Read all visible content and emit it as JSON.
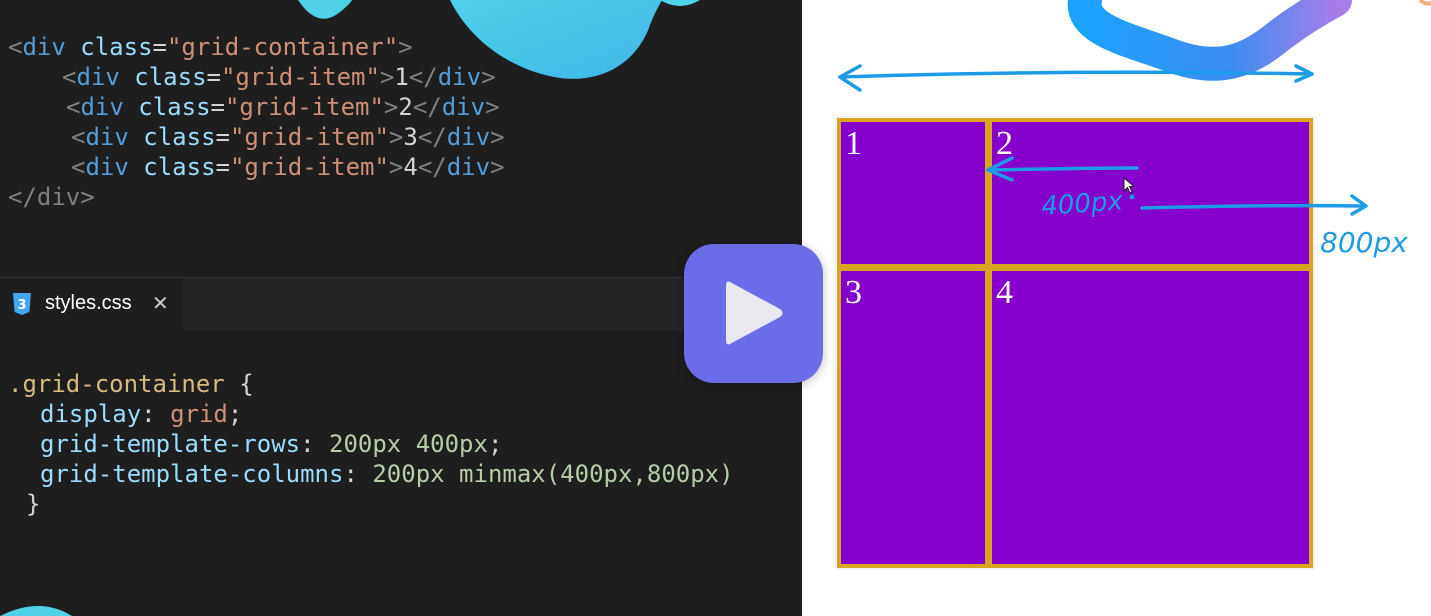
{
  "html_code": {
    "lines": [
      {
        "indent": "",
        "tag": "div",
        "attr": "class",
        "value": "\"grid-container\"",
        "content": ""
      },
      {
        "indent": "   ",
        "tag": "div",
        "attr": "class",
        "value": "\"grid-item\"",
        "content": "1"
      },
      {
        "indent": "   ",
        "tag": "div",
        "attr": "class",
        "value": "\"grid-item\"",
        "content": "2"
      },
      {
        "indent": "   ",
        "tag": "div",
        "attr": "class",
        "value": "\"grid-item\"",
        "content": "3"
      },
      {
        "indent": "   ",
        "tag": "div",
        "attr": "class",
        "value": "\"grid-item\"",
        "content": "4"
      }
    ],
    "closing": "</div>"
  },
  "tab": {
    "icon": "css3-file-icon",
    "icon_glyph": "3",
    "label": "styles.css",
    "close_glyph": "✕"
  },
  "css_code": {
    "selector": ".grid-container",
    "open_brace": "{",
    "declarations": [
      {
        "property": "display",
        "value": "grid"
      },
      {
        "property": "grid-template-rows",
        "value": "200px 400px"
      },
      {
        "property": "grid-template-columns",
        "value": "200px minmax(400px,800px)"
      }
    ],
    "close_brace": "}"
  },
  "preview": {
    "items": [
      "1",
      "2",
      "3",
      "4"
    ],
    "item_color": "#8500cc",
    "gap_color": "#daa520",
    "annotations": {
      "width_label": "400px",
      "max_label": "800px",
      "ink_color": "#1e9be8"
    }
  },
  "play_button": {
    "icon": "play-icon",
    "color": "#6c6be8"
  }
}
